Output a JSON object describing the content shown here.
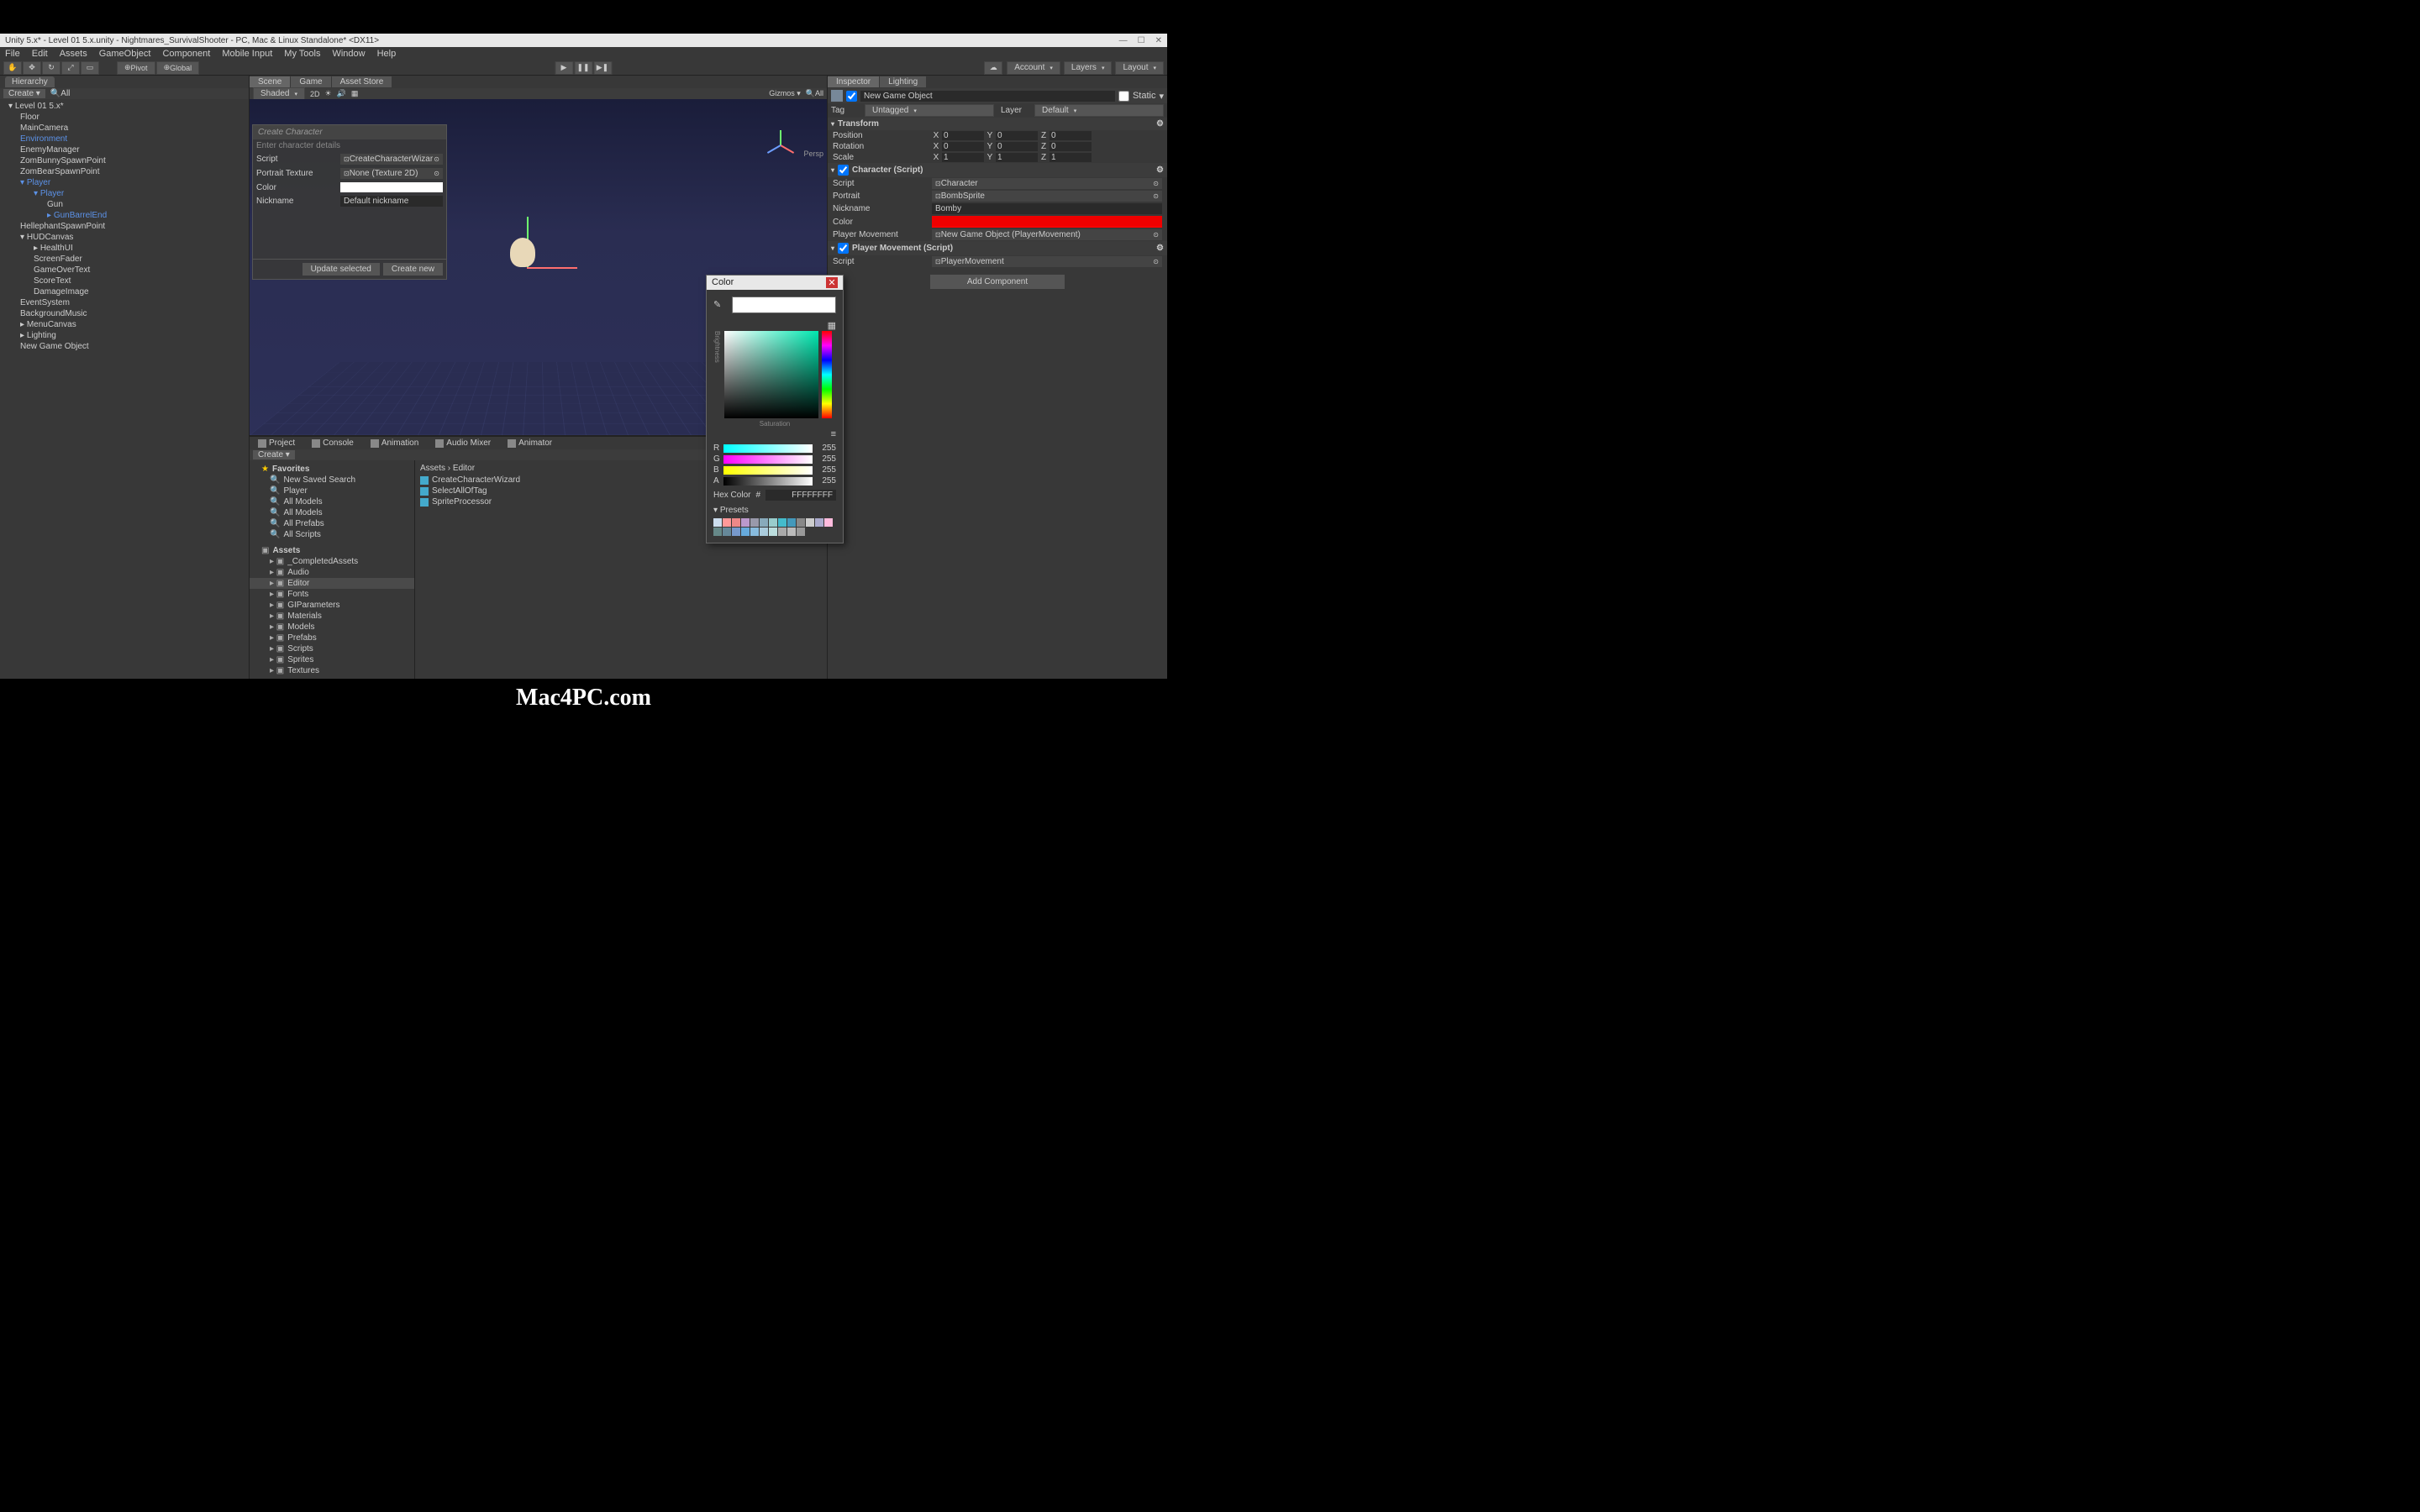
{
  "titlebar": "Unity 5.x* - Level 01 5.x.unity - Nightmares_SurvivalShooter - PC, Mac & Linux Standalone* <DX11>",
  "menubar": [
    "File",
    "Edit",
    "Assets",
    "GameObject",
    "Component",
    "Mobile Input",
    "My Tools",
    "Window",
    "Help"
  ],
  "toolbar": {
    "pivot": "Pivot",
    "global": "Global",
    "account": "Account",
    "layers": "Layers",
    "layout": "Layout"
  },
  "hierarchy": {
    "title": "Hierarchy",
    "create": "Create",
    "search_ph": "All",
    "root": "Level 01 5.x*",
    "items": [
      {
        "t": "Floor",
        "l": 1
      },
      {
        "t": "MainCamera",
        "l": 1
      },
      {
        "t": "Environment",
        "l": 1,
        "blue": true
      },
      {
        "t": "EnemyManager",
        "l": 1
      },
      {
        "t": "ZomBunnySpawnPoint",
        "l": 1
      },
      {
        "t": "ZomBearSpawnPoint",
        "l": 1
      },
      {
        "t": "Player",
        "l": 1,
        "blue": true,
        "e": true
      },
      {
        "t": "Player",
        "l": 2,
        "blue": true,
        "e": true
      },
      {
        "t": "Gun",
        "l": 3
      },
      {
        "t": "GunBarrelEnd",
        "l": 3,
        "blue": true,
        "c": true
      },
      {
        "t": "HellephantSpawnPoint",
        "l": 1
      },
      {
        "t": "HUDCanvas",
        "l": 1,
        "e": true
      },
      {
        "t": "HealthUI",
        "l": 2,
        "c": true
      },
      {
        "t": "ScreenFader",
        "l": 2
      },
      {
        "t": "GameOverText",
        "l": 2
      },
      {
        "t": "ScoreText",
        "l": 2
      },
      {
        "t": "DamageImage",
        "l": 2
      },
      {
        "t": "EventSystem",
        "l": 1
      },
      {
        "t": "BackgroundMusic",
        "l": 1
      },
      {
        "t": "MenuCanvas",
        "l": 1,
        "c": true
      },
      {
        "t": "Lighting",
        "l": 1,
        "c": true
      },
      {
        "t": "New Game Object",
        "l": 1
      }
    ]
  },
  "centerTabs": [
    {
      "label": "Scene",
      "active": true
    },
    {
      "label": "Game"
    },
    {
      "label": "Asset Store"
    }
  ],
  "sceneToolbar": {
    "shaded": "Shaded",
    "twoD": "2D",
    "gizmos": "Gizmos",
    "all": "All"
  },
  "gizmo_persp": "Persp",
  "wizard": {
    "title": "Create Character",
    "subtitle": "Enter character details",
    "rows": [
      {
        "label": "Script",
        "value": "CreateCharacterWizar"
      },
      {
        "label": "Portrait Texture",
        "value": "None (Texture 2D)"
      },
      {
        "label": "Color"
      },
      {
        "label": "Nickname",
        "value": "Default nickname"
      }
    ],
    "update": "Update selected",
    "create": "Create new"
  },
  "bottomTabs": [
    "Project",
    "Console",
    "Animation",
    "Audio Mixer",
    "Animator"
  ],
  "project": {
    "create": "Create",
    "favorites": "Favorites",
    "fav_items": [
      "New Saved Search",
      "Player",
      "All Models",
      "All Models",
      "All Prefabs",
      "All Scripts"
    ],
    "assets": "Assets",
    "folders": [
      "_CompletedAssets",
      "Audio",
      "Editor",
      "Fonts",
      "GIParameters",
      "Materials",
      "Models",
      "Prefabs",
      "Scripts",
      "Sprites",
      "Textures"
    ],
    "selected": "Editor",
    "breadcrumb": "Assets  ›  Editor",
    "files": [
      "CreateCharacterWizard",
      "SelectAllOfTag",
      "SpriteProcessor"
    ]
  },
  "inspector": {
    "tabs": [
      "Inspector",
      "Lighting"
    ],
    "objectName": "New Game Object",
    "static": "Static",
    "tag": "Tag",
    "tag_val": "Untagged",
    "layer": "Layer",
    "layer_val": "Default",
    "transform": {
      "title": "Transform",
      "pos": "Position",
      "rot": "Rotation",
      "scale": "Scale",
      "px": "0",
      "py": "0",
      "pz": "0",
      "rx": "0",
      "ry": "0",
      "rz": "0",
      "sx": "1",
      "sy": "1",
      "sz": "1"
    },
    "charScript": {
      "title": "Character (Script)",
      "script": "Script",
      "script_val": "Character",
      "portrait": "Portrait",
      "portrait_val": "BombSprite",
      "nickname": "Nickname",
      "nickname_val": "Bomby",
      "color": "Color",
      "playerMove": "Player Movement",
      "playerMove_val": "New Game Object (PlayerMovement)"
    },
    "pmScript": {
      "title": "Player Movement (Script)",
      "script": "Script",
      "script_val": "PlayerMovement"
    },
    "addComponent": "Add Component"
  },
  "colorPicker": {
    "title": "Color",
    "saturation": "Saturation",
    "brightness": "Brightness",
    "r": "R",
    "rv": "255",
    "g": "G",
    "gv": "255",
    "b": "B",
    "bv": "255",
    "a": "A",
    "av": "255",
    "hex_label": "Hex Color",
    "hex_prefix": "#",
    "hex": "FFFFFFFF",
    "presets": "Presets",
    "swatches": [
      "#cde",
      "#f99",
      "#e88",
      "#b9c",
      "#99a",
      "#8ab",
      "#9cc",
      "#4bc",
      "#49b",
      "#888",
      "#ccc",
      "#aac",
      "#fbd",
      "#688",
      "#689",
      "#79c",
      "#6ad",
      "#8bd",
      "#acd",
      "#bdd",
      "#aaa",
      "#bbb",
      "#999"
    ]
  },
  "watermark": "Mac4PC.com"
}
